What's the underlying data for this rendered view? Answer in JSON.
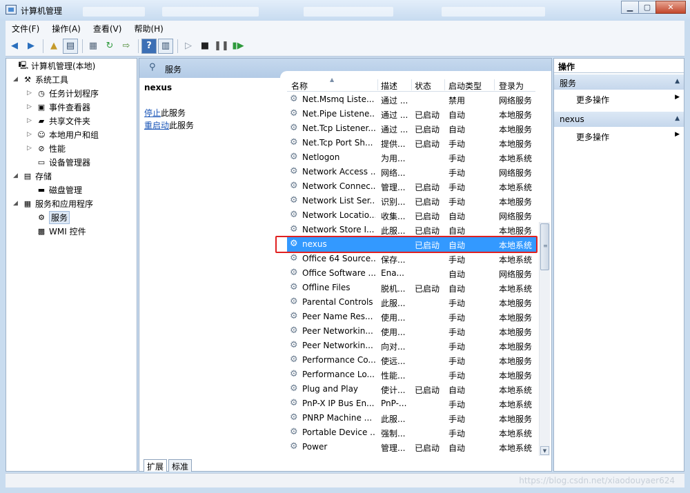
{
  "window": {
    "title": "计算机管理"
  },
  "menu": [
    "文件(F)",
    "操作(A)",
    "查看(V)",
    "帮助(H)"
  ],
  "tree": [
    {
      "label": "计算机管理(本地)",
      "level": 0,
      "arrow": "",
      "icon": "computer-icon"
    },
    {
      "label": "系统工具",
      "level": 1,
      "arrow": "◢",
      "icon": "tools-icon"
    },
    {
      "label": "任务计划程序",
      "level": 2,
      "arrow": "▷",
      "icon": "clock-icon"
    },
    {
      "label": "事件查看器",
      "level": 2,
      "arrow": "▷",
      "icon": "event-viewer-icon"
    },
    {
      "label": "共享文件夹",
      "level": 2,
      "arrow": "▷",
      "icon": "shared-folder-icon"
    },
    {
      "label": "本地用户和组",
      "level": 2,
      "arrow": "▷",
      "icon": "users-icon"
    },
    {
      "label": "性能",
      "level": 2,
      "arrow": "▷",
      "icon": "performance-icon"
    },
    {
      "label": "设备管理器",
      "level": 2,
      "arrow": "",
      "icon": "device-manager-icon"
    },
    {
      "label": "存储",
      "level": 1,
      "arrow": "◢",
      "icon": "storage-icon"
    },
    {
      "label": "磁盘管理",
      "level": 2,
      "arrow": "",
      "icon": "disk-icon"
    },
    {
      "label": "服务和应用程序",
      "level": 1,
      "arrow": "◢",
      "icon": "services-apps-icon"
    },
    {
      "label": "服务",
      "level": 2,
      "arrow": "",
      "icon": "gear-icon",
      "selected": true
    },
    {
      "label": "WMI 控件",
      "level": 2,
      "arrow": "",
      "icon": "wmi-icon"
    }
  ],
  "center": {
    "header": "服务",
    "selected_service": "nexus",
    "stop_link": "停止",
    "stop_suffix": "此服务",
    "restart_link": "重启动",
    "restart_suffix": "此服务",
    "columns": {
      "name": "名称",
      "desc": "描述",
      "status": "状态",
      "startup": "启动类型",
      "login": "登录为"
    },
    "tabs": [
      "扩展",
      "标准"
    ]
  },
  "services": [
    {
      "name": "Net.Msmq Liste...",
      "desc": "通过 ...",
      "status": "",
      "startup": "禁用",
      "login": "网络服务"
    },
    {
      "name": "Net.Pipe Listene...",
      "desc": "通过 ...",
      "status": "已启动",
      "startup": "自动",
      "login": "本地服务"
    },
    {
      "name": "Net.Tcp Listener...",
      "desc": "通过 ...",
      "status": "已启动",
      "startup": "自动",
      "login": "本地服务"
    },
    {
      "name": "Net.Tcp Port Sh...",
      "desc": "提供...",
      "status": "已启动",
      "startup": "手动",
      "login": "本地服务"
    },
    {
      "name": "Netlogon",
      "desc": "为用...",
      "status": "",
      "startup": "手动",
      "login": "本地系统"
    },
    {
      "name": "Network Access ...",
      "desc": "网络...",
      "status": "",
      "startup": "手动",
      "login": "网络服务"
    },
    {
      "name": "Network Connec...",
      "desc": "管理...",
      "status": "已启动",
      "startup": "手动",
      "login": "本地系统"
    },
    {
      "name": "Network List Ser...",
      "desc": "识别...",
      "status": "已启动",
      "startup": "手动",
      "login": "本地服务"
    },
    {
      "name": "Network Locatio...",
      "desc": "收集...",
      "status": "已启动",
      "startup": "自动",
      "login": "网络服务"
    },
    {
      "name": "Network Store I...",
      "desc": "此服...",
      "status": "已启动",
      "startup": "自动",
      "login": "本地服务"
    },
    {
      "name": "nexus",
      "desc": "",
      "status": "已启动",
      "startup": "自动",
      "login": "本地系统",
      "selected": true
    },
    {
      "name": "Office 64 Source...",
      "desc": "保存...",
      "status": "",
      "startup": "手动",
      "login": "本地系统"
    },
    {
      "name": "Office Software ...",
      "desc": "Ena...",
      "status": "",
      "startup": "自动",
      "login": "网络服务"
    },
    {
      "name": "Offline Files",
      "desc": "脱机...",
      "status": "已启动",
      "startup": "自动",
      "login": "本地系统"
    },
    {
      "name": "Parental Controls",
      "desc": "此服...",
      "status": "",
      "startup": "手动",
      "login": "本地服务"
    },
    {
      "name": "Peer Name Res...",
      "desc": "使用...",
      "status": "",
      "startup": "手动",
      "login": "本地服务"
    },
    {
      "name": "Peer Networkin...",
      "desc": "使用...",
      "status": "",
      "startup": "手动",
      "login": "本地服务"
    },
    {
      "name": "Peer Networkin...",
      "desc": "向对...",
      "status": "",
      "startup": "手动",
      "login": "本地服务"
    },
    {
      "name": "Performance Co...",
      "desc": "使远...",
      "status": "",
      "startup": "手动",
      "login": "本地服务"
    },
    {
      "name": "Performance Lo...",
      "desc": "性能...",
      "status": "",
      "startup": "手动",
      "login": "本地服务"
    },
    {
      "name": "Plug and Play",
      "desc": "使计...",
      "status": "已启动",
      "startup": "自动",
      "login": "本地系统"
    },
    {
      "name": "PnP-X IP Bus En...",
      "desc": "PnP-...",
      "status": "",
      "startup": "手动",
      "login": "本地系统"
    },
    {
      "name": "PNRP Machine ...",
      "desc": "此服...",
      "status": "",
      "startup": "手动",
      "login": "本地服务"
    },
    {
      "name": "Portable Device ...",
      "desc": "强制...",
      "status": "",
      "startup": "手动",
      "login": "本地系统"
    },
    {
      "name": "Power",
      "desc": "管理...",
      "status": "已启动",
      "startup": "自动",
      "login": "本地系统"
    }
  ],
  "actions": {
    "title": "操作",
    "section1": "服务",
    "section1_more": "更多操作",
    "section2": "nexus",
    "section2_more": "更多操作"
  },
  "watermark": "https://blog.csdn.net/xiaodouyaer624"
}
